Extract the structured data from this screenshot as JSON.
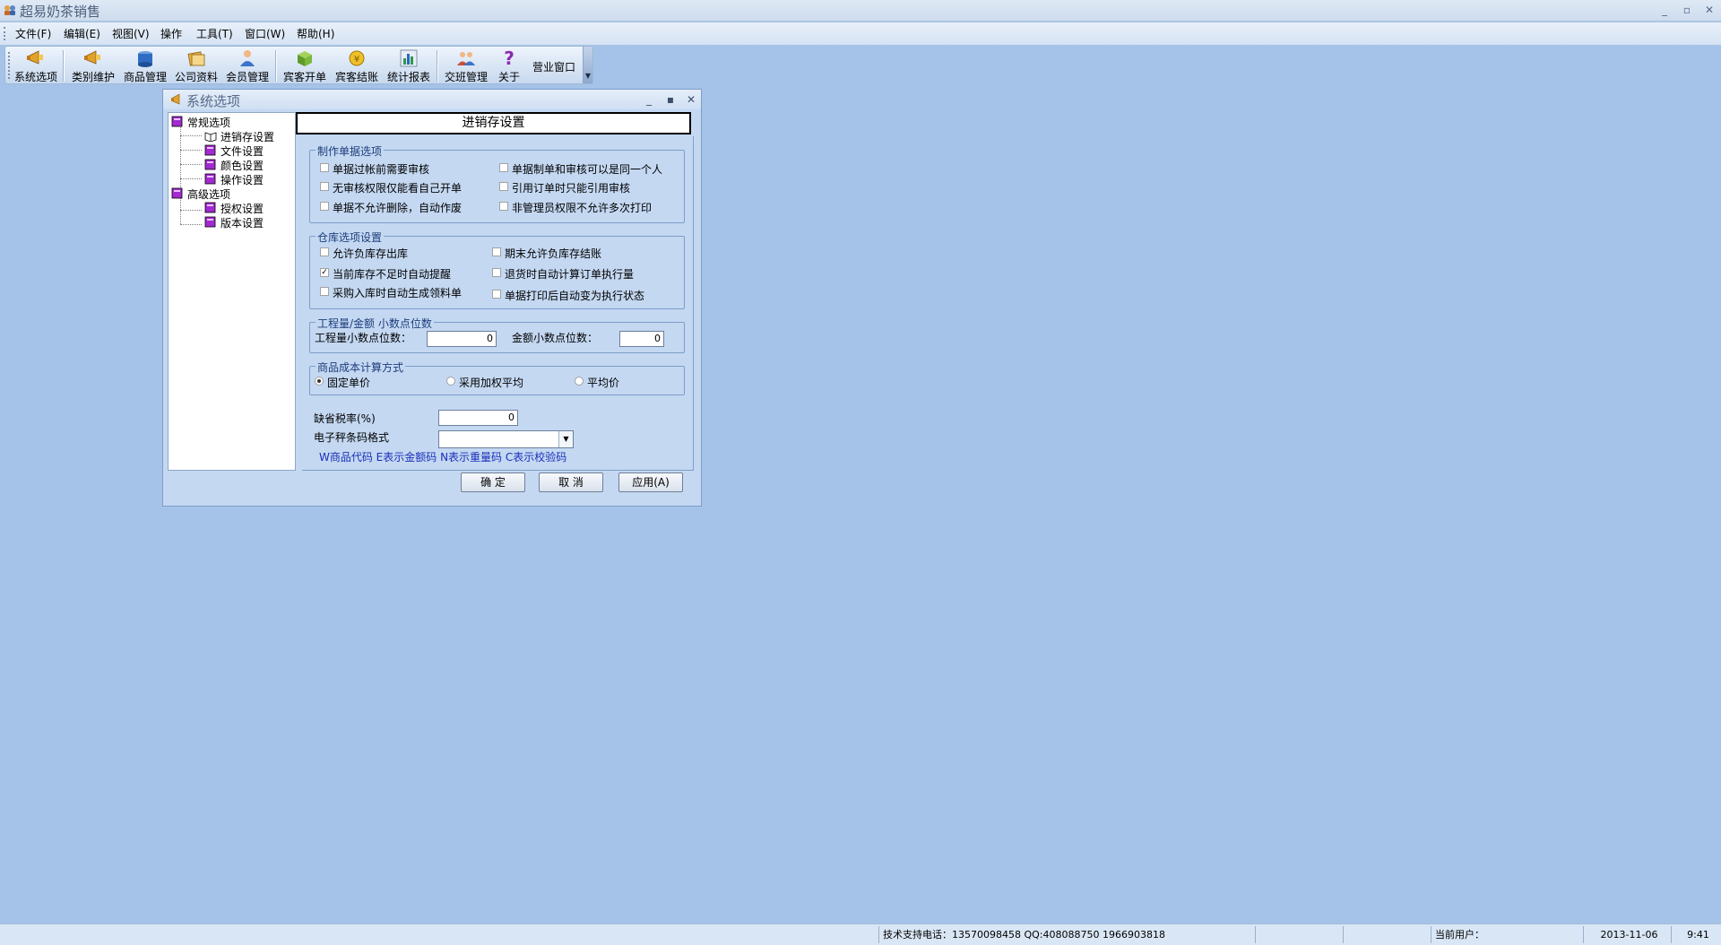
{
  "app": {
    "title": "超易奶茶销售"
  },
  "menu": [
    {
      "label": "文件(F)"
    },
    {
      "label": "编辑(E)"
    },
    {
      "label": "视图(V)"
    },
    {
      "label": "操作"
    },
    {
      "label": "工具(T)"
    },
    {
      "label": "窗口(W)"
    },
    {
      "label": "帮助(H)"
    }
  ],
  "toolbar": [
    {
      "label": "系统选项",
      "icon": "megaphone-icon"
    },
    {
      "label": "类别维护",
      "icon": "megaphone-icon"
    },
    {
      "label": "商品管理",
      "icon": "box-icon"
    },
    {
      "label": "公司资料",
      "icon": "files-icon"
    },
    {
      "label": "会员管理",
      "icon": "person-icon"
    },
    {
      "label": "宾客开单",
      "icon": "package-icon"
    },
    {
      "label": "宾客结账",
      "icon": "coin-icon"
    },
    {
      "label": "统计报表",
      "icon": "chart-icon"
    },
    {
      "label": "交班管理",
      "icon": "people-icon"
    },
    {
      "label": "关于",
      "icon": "question-icon"
    },
    {
      "label": "营业窗口"
    }
  ],
  "dialog": {
    "title": "系统选项",
    "page_title": "进销存设置",
    "tree": [
      {
        "label": "常规选项"
      },
      {
        "label": "进销存设置"
      },
      {
        "label": "文件设置"
      },
      {
        "label": "颜色设置"
      },
      {
        "label": "操作设置"
      },
      {
        "label": "高级选项"
      },
      {
        "label": "授权设置"
      },
      {
        "label": "版本设置"
      }
    ],
    "doc_group": {
      "title": "制作单据选项",
      "options": [
        {
          "label": "单据过帐前需要审核",
          "checked": false
        },
        {
          "label": "单据制单和审核可以是同一个人",
          "checked": false
        },
        {
          "label": "无审核权限仅能看自己开单",
          "checked": false
        },
        {
          "label": "引用订单时只能引用审核",
          "checked": false
        },
        {
          "label": "单据不允许删除，自动作废",
          "checked": false
        },
        {
          "label": "非管理员权限不允许多次打印",
          "checked": false
        }
      ]
    },
    "warehouse_group": {
      "title": "仓库选项设置",
      "options": [
        {
          "label": "允许负库存出库",
          "checked": false
        },
        {
          "label": "期末允许负库存结账",
          "checked": false
        },
        {
          "label": "当前库存不足时自动提醒",
          "checked": true,
          "mark": "✓"
        },
        {
          "label": "退货时自动计算订单执行量",
          "checked": false
        },
        {
          "label": "采购入库时自动生成领料单",
          "checked": false
        },
        {
          "label": "单据打印后自动变为执行状态",
          "checked": false
        }
      ]
    },
    "decimal_group": {
      "title": "工程量/金额 小数点位数",
      "qty_label": "工程量小数点位数：",
      "qty_value": "0",
      "amount_label": "金额小数点位数：",
      "amount_value": "0"
    },
    "cost_group": {
      "title": "商品成本计算方式",
      "options": [
        {
          "label": "固定单价",
          "selected": true
        },
        {
          "label": "采用加权平均",
          "selected": false
        },
        {
          "label": "平均价",
          "selected": false
        }
      ]
    },
    "tax_label": "缺省税率(%)",
    "tax_value": "0",
    "barcode_label": "电子秤条码格式",
    "barcode_value": "",
    "barcode_hint": "W商品代码 E表示金额码 N表示重量码 C表示校验码",
    "buttons": {
      "ok": "确 定",
      "cancel": "取 消",
      "apply": "应用(A)"
    }
  },
  "status": {
    "support": "技术支持电话：13570098458 QQ:408088750 1966903818",
    "user_label": "当前用户：",
    "user_value": "",
    "date": "2013-11-06",
    "time": "9:41"
  },
  "colors": {
    "desktop": "#a5c3e8",
    "dialog_bg": "#c4d8f2",
    "group_title": "#1c3d7a",
    "hint": "#1a2fb8"
  }
}
